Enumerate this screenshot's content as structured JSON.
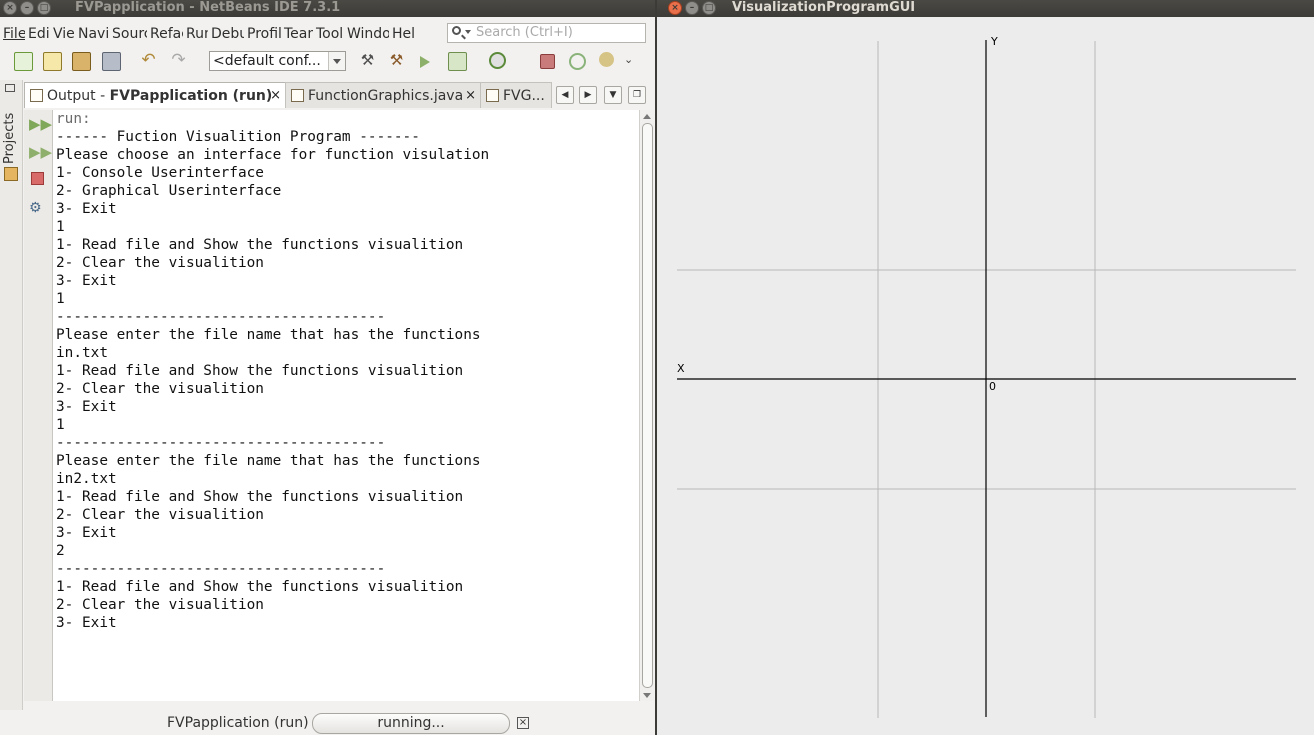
{
  "ide": {
    "title": "FVPapplication - NetBeans IDE 7.3.1",
    "menu": [
      "File",
      "Edit",
      "View",
      "Navigate",
      "Source",
      "Refactor",
      "Run",
      "Debug",
      "Profile",
      "Team",
      "Tools",
      "Window",
      "Help"
    ],
    "search_placeholder": "Search (Ctrl+I)",
    "config_value": "<default conf...",
    "side_panel_label": "Projects",
    "tabs": [
      {
        "prefix": "Output - ",
        "bold": "FVPapplication (run)",
        "close": "×"
      },
      {
        "label": "FunctionGraphics.java",
        "close": "×"
      },
      {
        "label": "FVG..."
      }
    ],
    "console_lines": [
      "run:",
      "------ Fuction Visualition Program -------",
      "Please choose an interface for function visulation",
      "1- Console Userinterface",
      "2- Graphical Userinterface",
      "3- Exit",
      "1",
      "1- Read file and Show the functions visualition",
      "2- Clear the visualition",
      "3- Exit",
      "1",
      "--------------------------------------",
      "Please enter the file name that has the functions",
      "in.txt",
      "1- Read file and Show the functions visualition",
      "2- Clear the visualition",
      "3- Exit",
      "1",
      "--------------------------------------",
      "Please enter the file name that has the functions",
      "in2.txt",
      "1- Read file and Show the functions visualition",
      "2- Clear the visualition",
      "3- Exit",
      "2",
      "--------------------------------------",
      "1- Read file and Show the functions visualition",
      "2- Clear the visualition",
      "3- Exit"
    ],
    "status_label": "FVPapplication (run)",
    "progress_text": "running...",
    "progress_close": "×"
  },
  "gui": {
    "title": "VisualizationProgramGUI",
    "y_axis_label": "Y",
    "x_axis_label": "X",
    "origin_label": "0"
  },
  "colors": {
    "titlebar": "#3c3b37",
    "close_button": "#e9704b",
    "grid": "#b8b8b8",
    "axis": "#000000"
  }
}
